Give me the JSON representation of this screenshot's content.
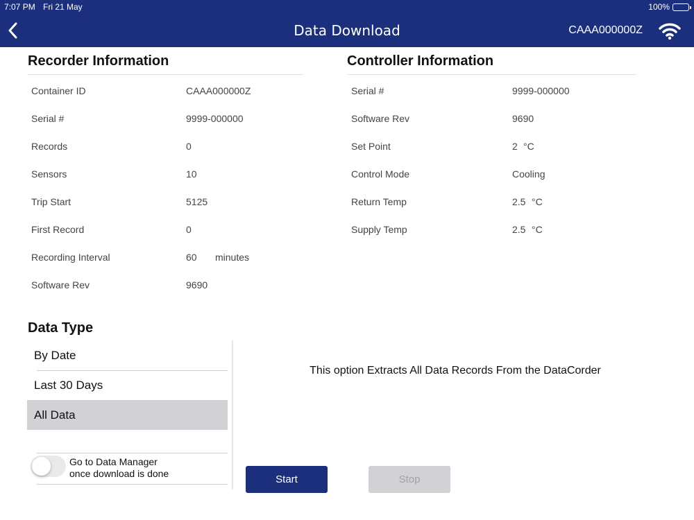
{
  "status_bar": {
    "time": "7:07 PM",
    "date": "Fri 21 May",
    "battery": "100%"
  },
  "header": {
    "title": "Data Download",
    "container_id": "CAAA000000Z"
  },
  "recorder": {
    "title": "Recorder Information",
    "rows": [
      {
        "label": "Container ID",
        "value": "CAAA000000Z"
      },
      {
        "label": "Serial #",
        "value": "9999-000000"
      },
      {
        "label": "Records",
        "value": "0"
      },
      {
        "label": "Sensors",
        "value": "10"
      },
      {
        "label": "Trip Start",
        "value": "5125"
      },
      {
        "label": "First Record",
        "value": "0"
      },
      {
        "label": "Recording Interval",
        "value": "60",
        "unit": "minutes"
      },
      {
        "label": "Software Rev",
        "value": "9690"
      }
    ]
  },
  "controller": {
    "title": "Controller Information",
    "rows": [
      {
        "label": "Serial #",
        "value": "9999-000000"
      },
      {
        "label": "Software Rev",
        "value": "9690"
      },
      {
        "label": "Set Point",
        "value": "2",
        "unit": "°C"
      },
      {
        "label": "Control Mode",
        "value": "Cooling"
      },
      {
        "label": "Return Temp",
        "value": "2.5",
        "unit": "°C"
      },
      {
        "label": "Supply Temp",
        "value": "2.5",
        "unit": "°C"
      }
    ]
  },
  "data_type": {
    "title": "Data Type",
    "options": [
      {
        "label": "By Date",
        "selected": false
      },
      {
        "label": "Last 30 Days",
        "selected": false
      },
      {
        "label": "All Data",
        "selected": true
      }
    ],
    "description": "This option Extracts All Data Records From the DataCorder"
  },
  "toggle": {
    "line1": "Go to Data Manager",
    "line2": "once download is done",
    "on": false
  },
  "buttons": {
    "start": "Start",
    "stop": "Stop"
  },
  "colors": {
    "header_bg": "#1c2f7d",
    "selected_bg": "#d1d1d6",
    "start_bg": "#1c2f7d",
    "stop_bg": "#d1d1d6"
  },
  "icons": {
    "back": "chevron-left-icon",
    "wifi": "wifi-icon",
    "battery": "battery-icon"
  }
}
